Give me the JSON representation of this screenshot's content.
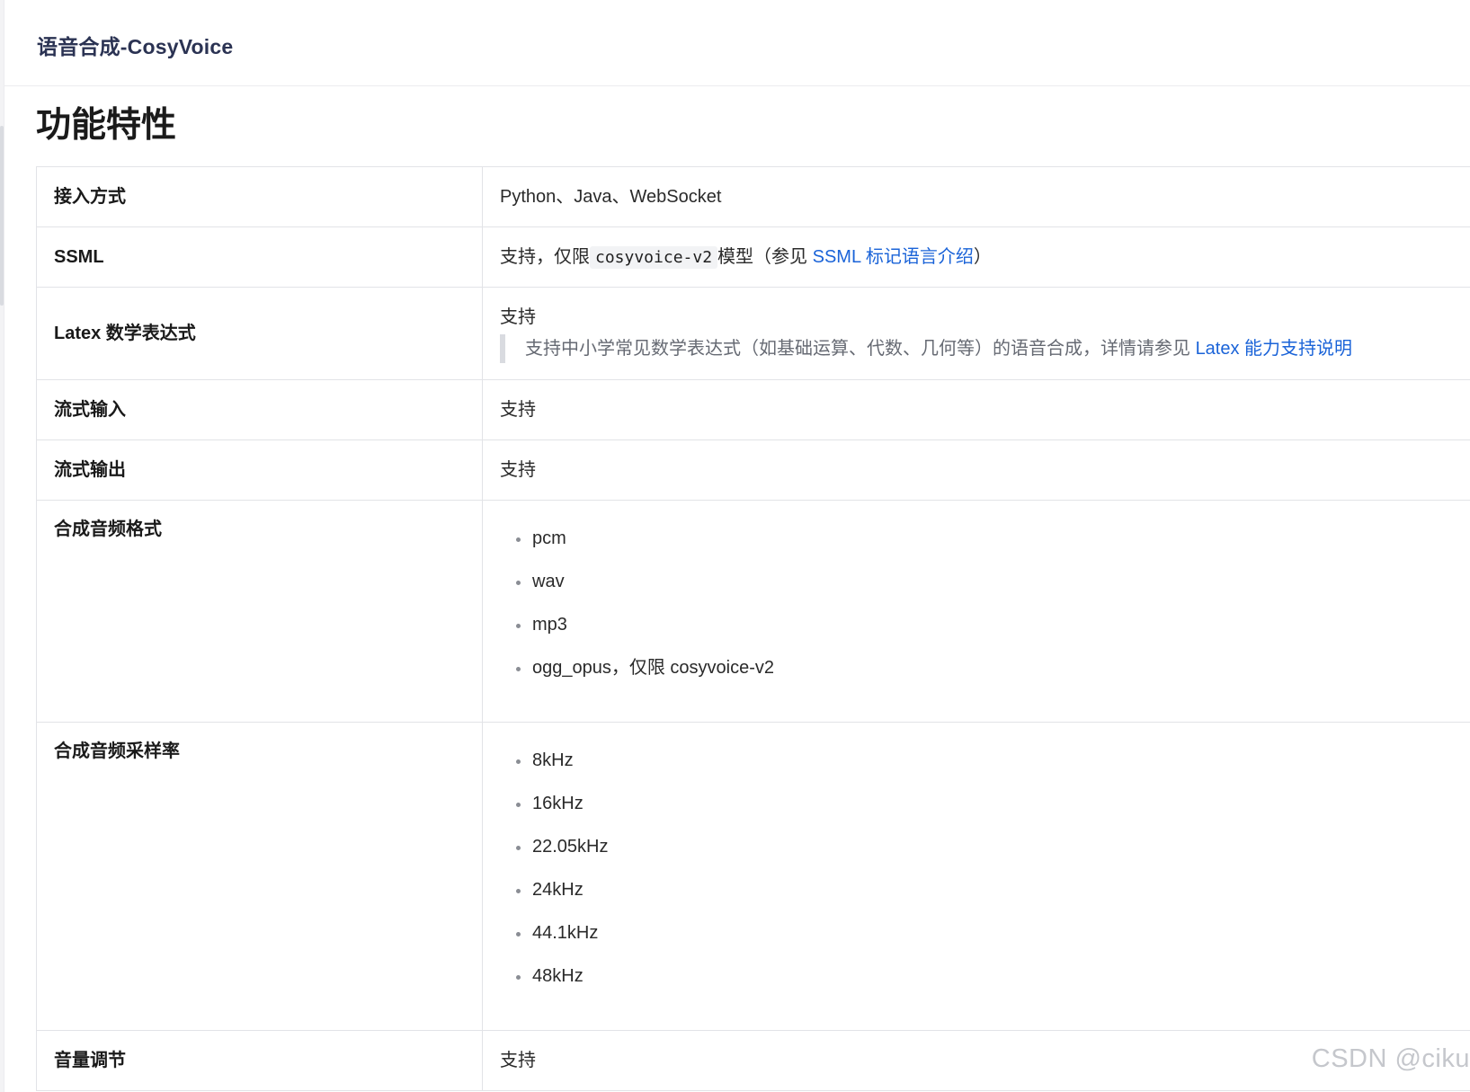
{
  "header": {
    "title": "语音合成-CosyVoice"
  },
  "section": {
    "title": "功能特性"
  },
  "rows": {
    "access": {
      "key": "接入方式",
      "value": "Python、Java、WebSocket"
    },
    "ssml": {
      "key": "SSML",
      "prefix": "支持，仅限",
      "code": "cosyvoice-v2",
      "middle": "模型（参见",
      "link": "SSML 标记语言介绍",
      "suffix": "）"
    },
    "latex": {
      "key": "Latex 数学表达式",
      "value": "支持",
      "note": "支持中小学常见数学表达式（如基础运算、代数、几何等）的语音合成，详情请参见",
      "note_link": "Latex 能力支持说明"
    },
    "stream_input": {
      "key": "流式输入",
      "value": "支持"
    },
    "stream_output": {
      "key": "流式输出",
      "value": "支持"
    },
    "audio_format": {
      "key": "合成音频格式",
      "items": [
        "pcm",
        "wav",
        "mp3",
        "ogg_opus，仅限 cosyvoice-v2"
      ]
    },
    "sample_rate": {
      "key": "合成音频采样率",
      "items": [
        "8kHz",
        "16kHz",
        "22.05kHz",
        "24kHz",
        "44.1kHz",
        "48kHz"
      ]
    },
    "volume": {
      "key": "音量调节",
      "value": "支持"
    }
  },
  "watermark": "CSDN @ciku",
  "colors": {
    "link": "#1a63d8",
    "title": "#2b3353",
    "border": "#e2e3e7"
  }
}
